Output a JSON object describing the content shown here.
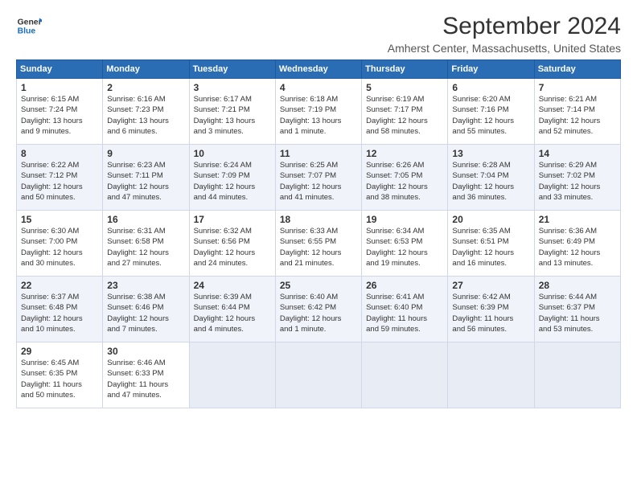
{
  "header": {
    "logo_line1": "General",
    "logo_line2": "Blue",
    "title": "September 2024",
    "subtitle": "Amherst Center, Massachusetts, United States"
  },
  "calendar": {
    "columns": [
      "Sunday",
      "Monday",
      "Tuesday",
      "Wednesday",
      "Thursday",
      "Friday",
      "Saturday"
    ],
    "weeks": [
      [
        {
          "day": "1",
          "info": "Sunrise: 6:15 AM\nSunset: 7:24 PM\nDaylight: 13 hours\nand 9 minutes."
        },
        {
          "day": "2",
          "info": "Sunrise: 6:16 AM\nSunset: 7:23 PM\nDaylight: 13 hours\nand 6 minutes."
        },
        {
          "day": "3",
          "info": "Sunrise: 6:17 AM\nSunset: 7:21 PM\nDaylight: 13 hours\nand 3 minutes."
        },
        {
          "day": "4",
          "info": "Sunrise: 6:18 AM\nSunset: 7:19 PM\nDaylight: 13 hours\nand 1 minute."
        },
        {
          "day": "5",
          "info": "Sunrise: 6:19 AM\nSunset: 7:17 PM\nDaylight: 12 hours\nand 58 minutes."
        },
        {
          "day": "6",
          "info": "Sunrise: 6:20 AM\nSunset: 7:16 PM\nDaylight: 12 hours\nand 55 minutes."
        },
        {
          "day": "7",
          "info": "Sunrise: 6:21 AM\nSunset: 7:14 PM\nDaylight: 12 hours\nand 52 minutes."
        }
      ],
      [
        {
          "day": "8",
          "info": "Sunrise: 6:22 AM\nSunset: 7:12 PM\nDaylight: 12 hours\nand 50 minutes."
        },
        {
          "day": "9",
          "info": "Sunrise: 6:23 AM\nSunset: 7:11 PM\nDaylight: 12 hours\nand 47 minutes."
        },
        {
          "day": "10",
          "info": "Sunrise: 6:24 AM\nSunset: 7:09 PM\nDaylight: 12 hours\nand 44 minutes."
        },
        {
          "day": "11",
          "info": "Sunrise: 6:25 AM\nSunset: 7:07 PM\nDaylight: 12 hours\nand 41 minutes."
        },
        {
          "day": "12",
          "info": "Sunrise: 6:26 AM\nSunset: 7:05 PM\nDaylight: 12 hours\nand 38 minutes."
        },
        {
          "day": "13",
          "info": "Sunrise: 6:28 AM\nSunset: 7:04 PM\nDaylight: 12 hours\nand 36 minutes."
        },
        {
          "day": "14",
          "info": "Sunrise: 6:29 AM\nSunset: 7:02 PM\nDaylight: 12 hours\nand 33 minutes."
        }
      ],
      [
        {
          "day": "15",
          "info": "Sunrise: 6:30 AM\nSunset: 7:00 PM\nDaylight: 12 hours\nand 30 minutes."
        },
        {
          "day": "16",
          "info": "Sunrise: 6:31 AM\nSunset: 6:58 PM\nDaylight: 12 hours\nand 27 minutes."
        },
        {
          "day": "17",
          "info": "Sunrise: 6:32 AM\nSunset: 6:56 PM\nDaylight: 12 hours\nand 24 minutes."
        },
        {
          "day": "18",
          "info": "Sunrise: 6:33 AM\nSunset: 6:55 PM\nDaylight: 12 hours\nand 21 minutes."
        },
        {
          "day": "19",
          "info": "Sunrise: 6:34 AM\nSunset: 6:53 PM\nDaylight: 12 hours\nand 19 minutes."
        },
        {
          "day": "20",
          "info": "Sunrise: 6:35 AM\nSunset: 6:51 PM\nDaylight: 12 hours\nand 16 minutes."
        },
        {
          "day": "21",
          "info": "Sunrise: 6:36 AM\nSunset: 6:49 PM\nDaylight: 12 hours\nand 13 minutes."
        }
      ],
      [
        {
          "day": "22",
          "info": "Sunrise: 6:37 AM\nSunset: 6:48 PM\nDaylight: 12 hours\nand 10 minutes."
        },
        {
          "day": "23",
          "info": "Sunrise: 6:38 AM\nSunset: 6:46 PM\nDaylight: 12 hours\nand 7 minutes."
        },
        {
          "day": "24",
          "info": "Sunrise: 6:39 AM\nSunset: 6:44 PM\nDaylight: 12 hours\nand 4 minutes."
        },
        {
          "day": "25",
          "info": "Sunrise: 6:40 AM\nSunset: 6:42 PM\nDaylight: 12 hours\nand 1 minute."
        },
        {
          "day": "26",
          "info": "Sunrise: 6:41 AM\nSunset: 6:40 PM\nDaylight: 11 hours\nand 59 minutes."
        },
        {
          "day": "27",
          "info": "Sunrise: 6:42 AM\nSunset: 6:39 PM\nDaylight: 11 hours\nand 56 minutes."
        },
        {
          "day": "28",
          "info": "Sunrise: 6:44 AM\nSunset: 6:37 PM\nDaylight: 11 hours\nand 53 minutes."
        }
      ],
      [
        {
          "day": "29",
          "info": "Sunrise: 6:45 AM\nSunset: 6:35 PM\nDaylight: 11 hours\nand 50 minutes."
        },
        {
          "day": "30",
          "info": "Sunrise: 6:46 AM\nSunset: 6:33 PM\nDaylight: 11 hours\nand 47 minutes."
        },
        {
          "day": "",
          "info": ""
        },
        {
          "day": "",
          "info": ""
        },
        {
          "day": "",
          "info": ""
        },
        {
          "day": "",
          "info": ""
        },
        {
          "day": "",
          "info": ""
        }
      ]
    ]
  }
}
